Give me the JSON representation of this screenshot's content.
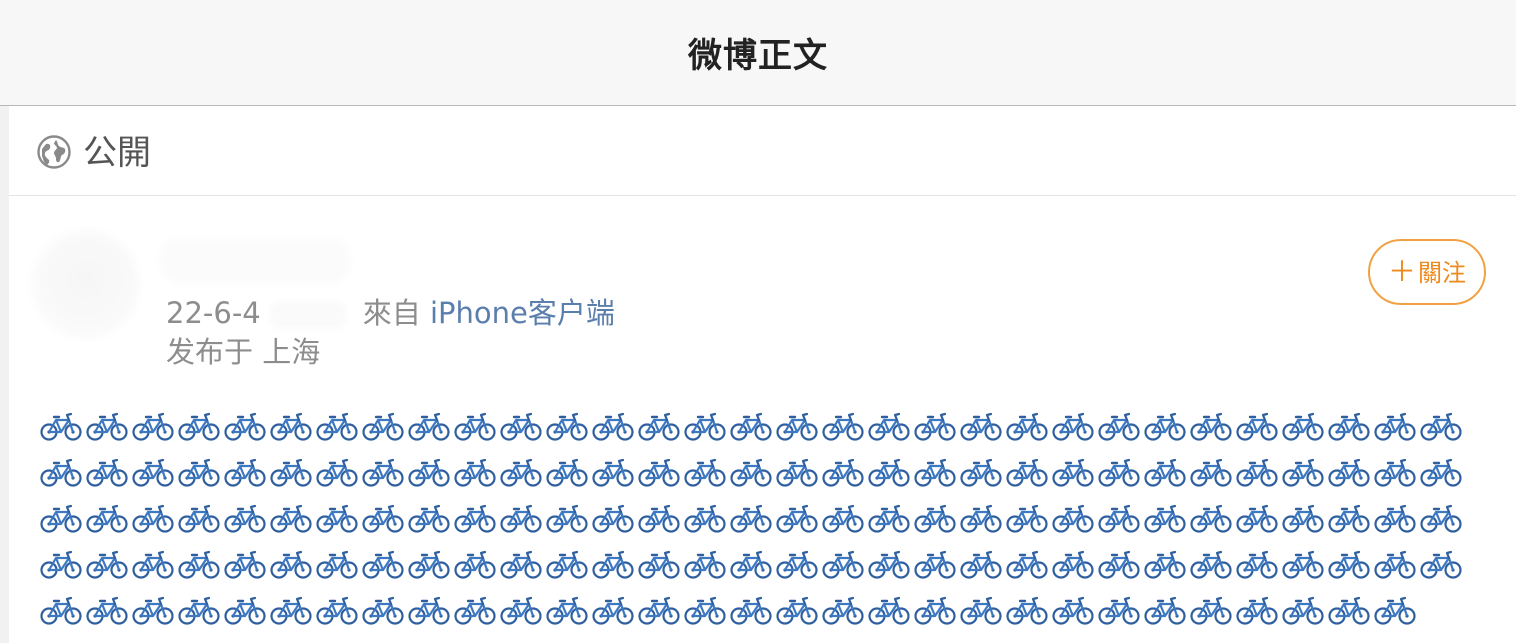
{
  "header": {
    "title": "微博正文"
  },
  "visibility": {
    "icon": "globe-icon",
    "label": "公開"
  },
  "post": {
    "date": "22-6-4",
    "source_prefix": "來自",
    "source_app": "iPhone客户端",
    "location": "发布于 上海",
    "follow_label": "關注",
    "follow_icon": "plus-icon",
    "content_emoji": "bicycle-emoji",
    "emoji_rows": [
      31,
      31,
      31,
      31,
      30
    ]
  },
  "colors": {
    "link": "#5b7fad",
    "follow_accent": "#ec8a1d",
    "follow_border": "#f0a243",
    "meta_text": "#8d8d8d",
    "bike_blue": "#3d6fb0"
  }
}
